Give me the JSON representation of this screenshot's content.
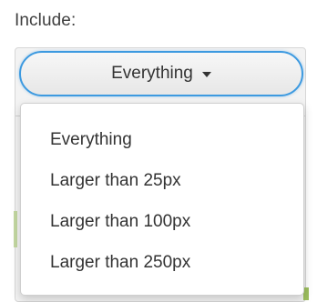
{
  "include_label": "Include:",
  "select": {
    "value": "Everything",
    "caret_icon": "caret-down-icon"
  },
  "menu": {
    "items": [
      {
        "label": "Everything"
      },
      {
        "label": "Larger than 25px"
      },
      {
        "label": "Larger than 100px"
      },
      {
        "label": "Larger than 250px"
      }
    ]
  },
  "colors": {
    "focus_ring": "#3d9ae0",
    "text": "#333333",
    "label_text": "#3f3f3f",
    "menu_border": "#cfcfcf"
  }
}
